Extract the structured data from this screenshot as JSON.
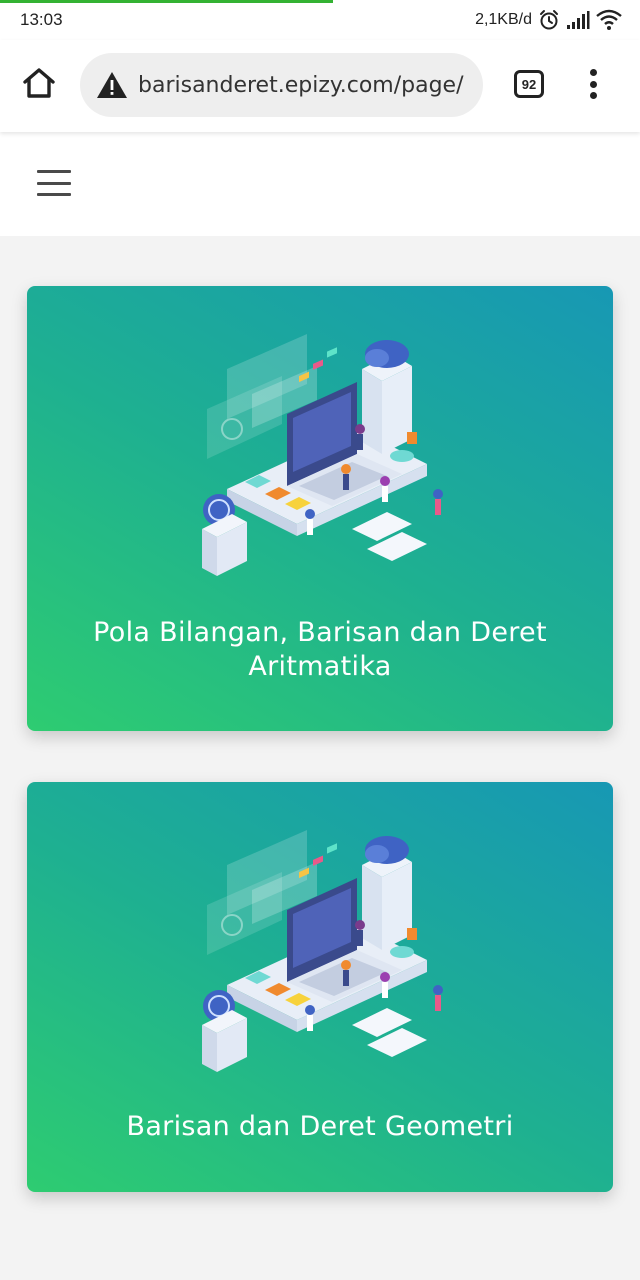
{
  "status_bar": {
    "time": "13:03",
    "network_speed": "2,1KB/d",
    "icons": [
      "alarm-icon",
      "signal-icon",
      "wifi-icon"
    ],
    "load_progress": 0.52
  },
  "browser": {
    "url": "barisanderet.epizy.com/page/",
    "tab_count": "92",
    "icons": [
      "home-icon",
      "insecure-warning-icon",
      "tabs-icon",
      "overflow-menu-icon"
    ]
  },
  "site": {
    "menu_icon": "hamburger-menu-icon"
  },
  "cards": [
    {
      "title": "Pola Bilangan, Barisan dan Deret Aritmatika",
      "image": "isometric-computer-illustration"
    },
    {
      "title": "Barisan dan Deret Geometri",
      "image": "isometric-computer-illustration"
    }
  ],
  "colors": {
    "card_gradient_start": "#2ecc71",
    "card_gradient_end": "#1798b4",
    "progress": "#34b233",
    "page_background": "#f3f3f3"
  }
}
